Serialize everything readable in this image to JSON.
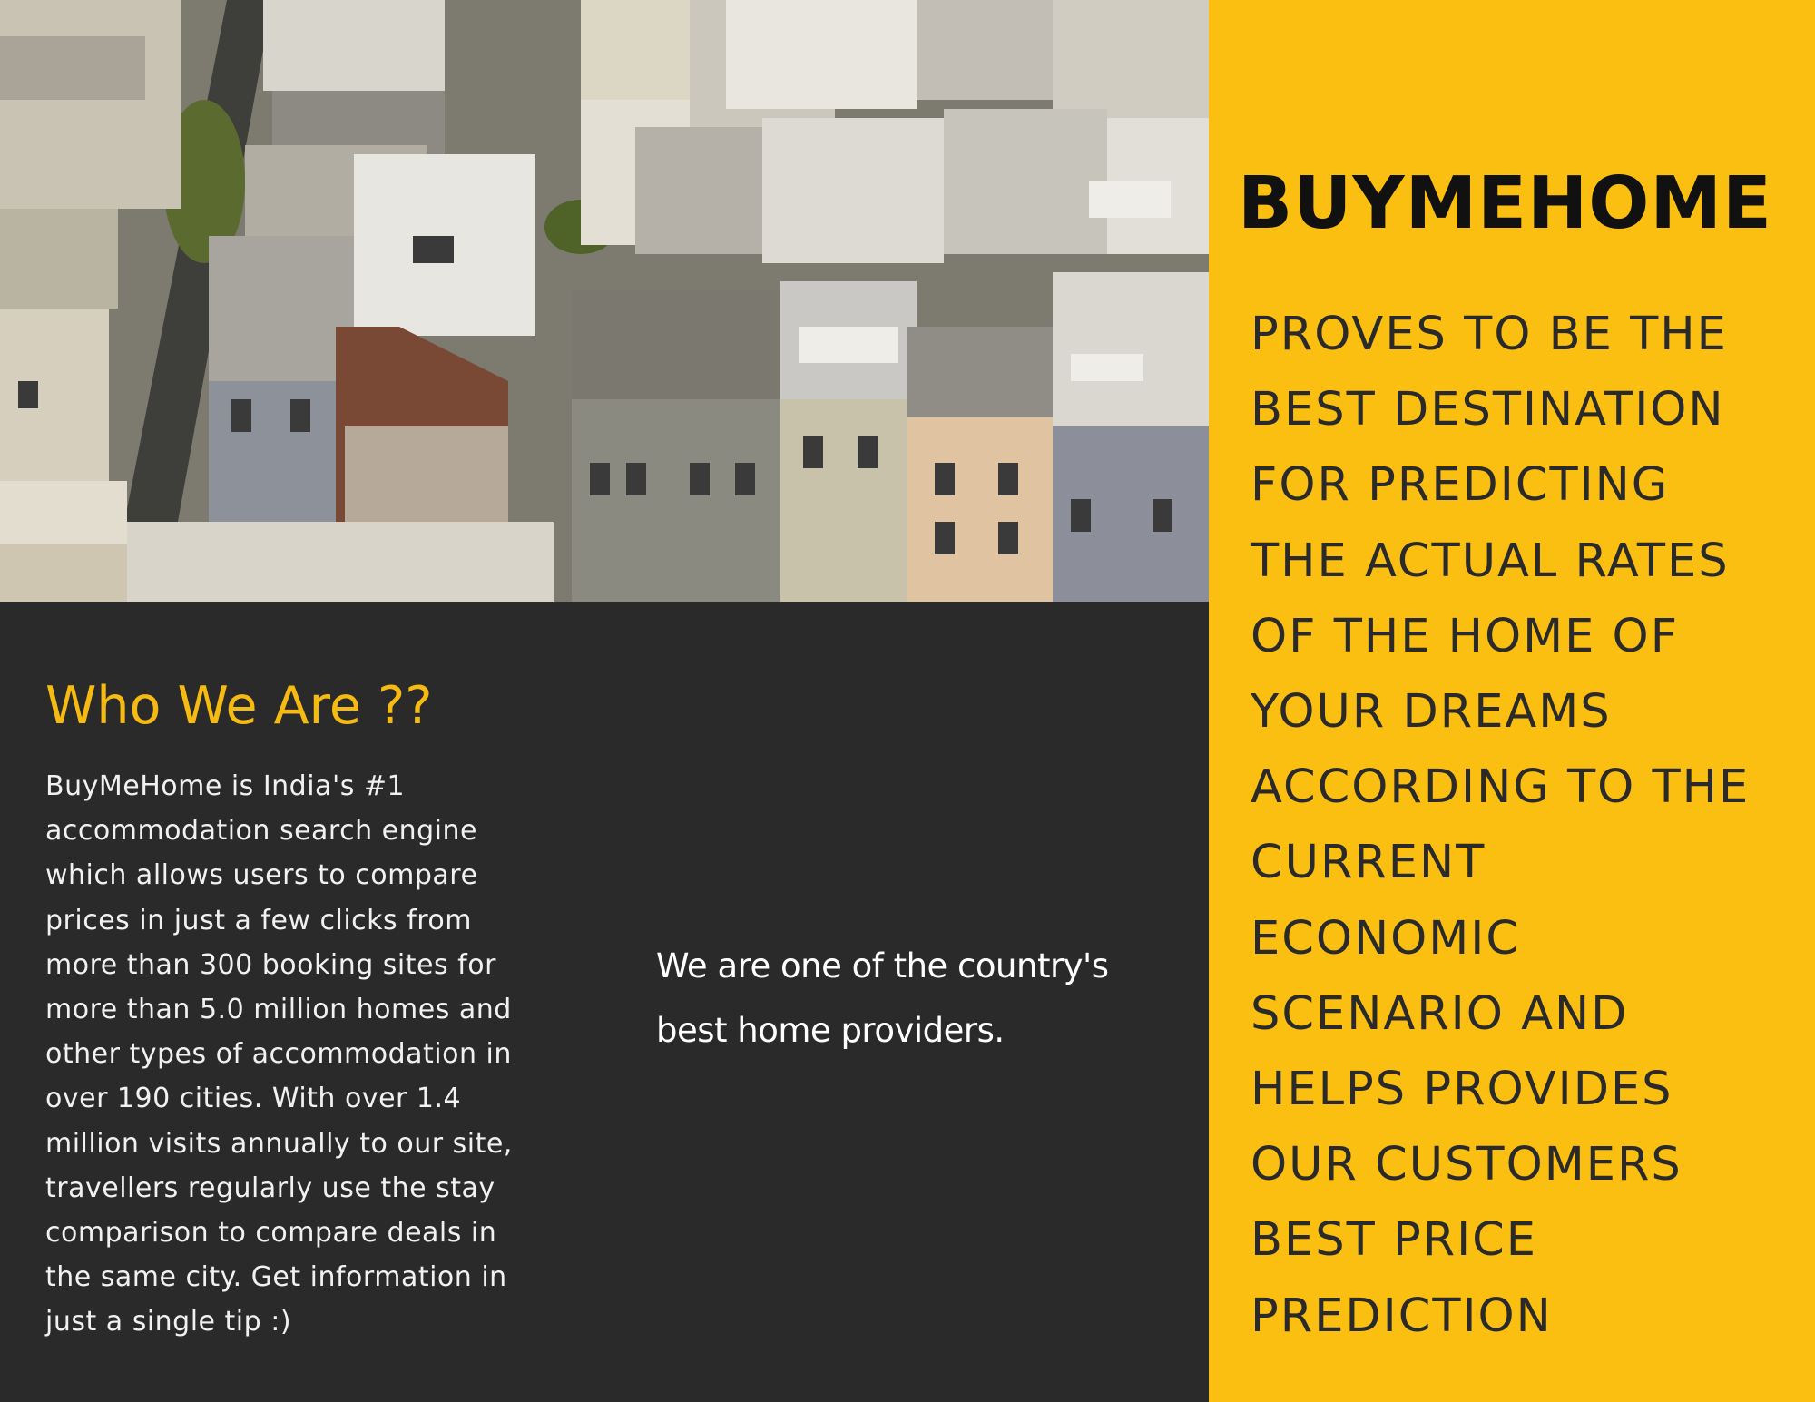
{
  "brand": {
    "name": "BUYMEHOME",
    "tagline_lines": [
      "PROVES TO BE THE",
      "BEST DESTINATION",
      "FOR PREDICTING",
      "THE ACTUAL RATES",
      "OF THE HOME OF",
      "YOUR DREAMS",
      "ACCORDING TO THE",
      "CURRENT",
      "ECONOMIC",
      "SCENARIO AND",
      "HELPS PROVIDES",
      "OUR CUSTOMERS",
      "BEST PRICE",
      "PREDICTION"
    ]
  },
  "who": {
    "title": "Who We Are ??",
    "body_lines": [
      "BuyMeHome is India's #1",
      "accommodation search engine",
      "which allows users to compare",
      "prices in just a few clicks from",
      "more than 300 booking sites for",
      "more than 5.0 million homes and",
      "other types of accommodation in",
      "over 190 cities. With over 1.4",
      "million visits annually to our site,",
      "travellers regularly use the stay",
      "comparison to compare deals in",
      "the same city. Get information in",
      "just a single tip :)"
    ]
  },
  "providers": {
    "lines": [
      "We are one of the country's",
      "best home providers."
    ]
  },
  "colors": {
    "accent_yellow": "#fbbf11",
    "dark_background": "#2a2a2a",
    "title_yellow": "#f5bb12"
  }
}
